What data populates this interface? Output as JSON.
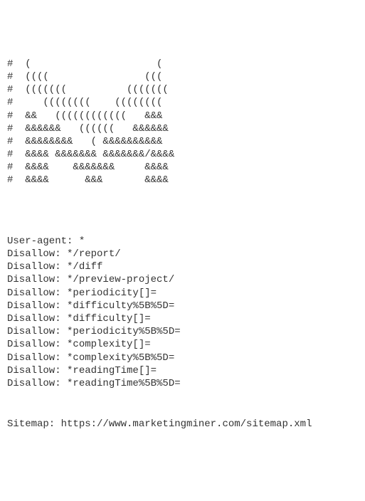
{
  "ascii_art": {
    "lines": [
      "#  (                     (",
      "#  ((((                (((",
      "#  (((((((          (((((((",
      "#     ((((((((    ((((((((",
      "#  &&   ((((((((((((   &&&",
      "#  &&&&&&   ((((((   &&&&&&",
      "#  &&&&&&&&   ( &&&&&&&&&&",
      "#  &&&& &&&&&&& &&&&&&&/&&&&",
      "#  &&&&    &&&&&&&     &&&&",
      "#  &&&&      &&&       &&&&"
    ]
  },
  "robots": {
    "user_agent": "User-agent: *",
    "disallow_rules": [
      "Disallow: */report/",
      "Disallow: */diff",
      "Disallow: */preview-project/",
      "Disallow: *periodicity[]=",
      "Disallow: *difficulty%5B%5D=",
      "Disallow: *difficulty[]=",
      "Disallow: *periodicity%5B%5D=",
      "Disallow: *complexity[]=",
      "Disallow: *complexity%5B%5D=",
      "Disallow: *readingTime[]=",
      "Disallow: *readingTime%5B%5D="
    ],
    "sitemap": "Sitemap: https://www.marketingminer.com/sitemap.xml"
  }
}
